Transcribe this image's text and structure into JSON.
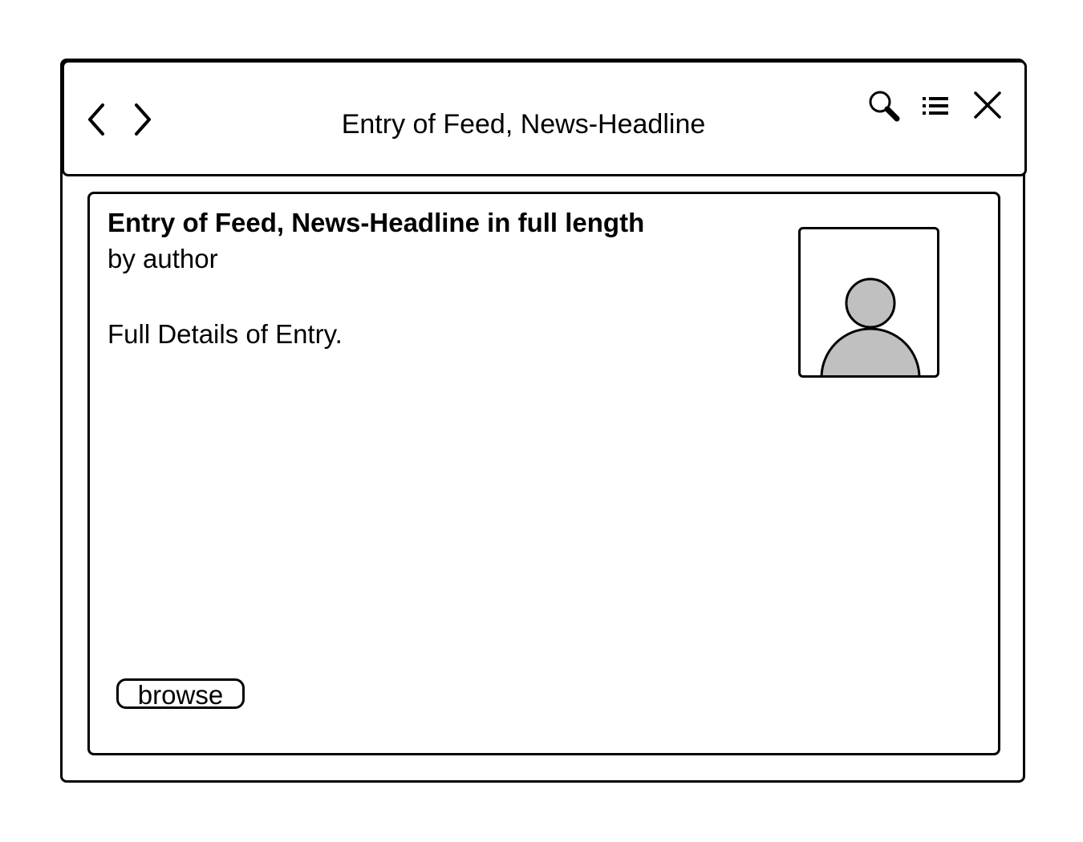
{
  "window": {
    "title": "Entry of Feed, News-Headline"
  },
  "toolbar": {
    "icons": [
      "chevron-left-icon",
      "chevron-right-icon",
      "search-icon",
      "list-icon",
      "close-icon"
    ]
  },
  "entry": {
    "headline": "Entry of Feed, News-Headline in full length",
    "byline": "by author",
    "details": "Full Details of Entry.",
    "image_icon": "user-avatar-icon"
  },
  "actions": {
    "browse_label": "browse"
  },
  "colors": {
    "stroke": "#000000",
    "background": "#ffffff",
    "avatar_fill": "#c0c0c0"
  }
}
